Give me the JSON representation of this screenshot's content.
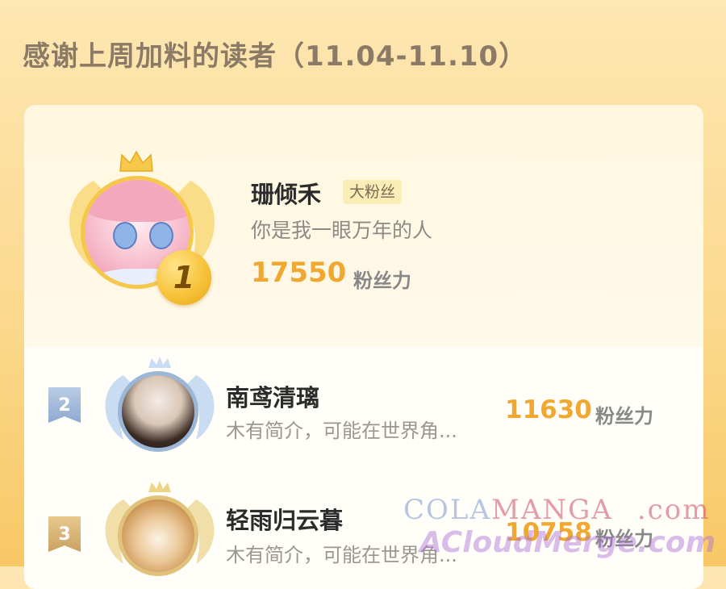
{
  "header": {
    "title": "感谢上周加料的读者（11.04-11.10）"
  },
  "top": {
    "rank": "1",
    "name": "珊倾禾",
    "tag": "大粉丝",
    "bio": "你是我一眼万年的人",
    "score": "17550",
    "unit": "粉丝力"
  },
  "rows": [
    {
      "rank": "2",
      "name": "南鸢清璃",
      "bio": "木有简介，可能在世界角...",
      "score": "11630",
      "unit": "粉丝力"
    },
    {
      "rank": "3",
      "name": "轻雨归云暮",
      "bio": "木有简介，可能在世界角...",
      "score": "10758",
      "unit": "粉丝力"
    }
  ],
  "watermark": {
    "line1_a": "COLA",
    "line1_b": "MANGA",
    "line1_c": ".com",
    "line2": "ACloudMerge.com"
  },
  "colors": {
    "accent": "#f0a830",
    "gold": "#f5c84a",
    "background": "#fbd98e"
  }
}
